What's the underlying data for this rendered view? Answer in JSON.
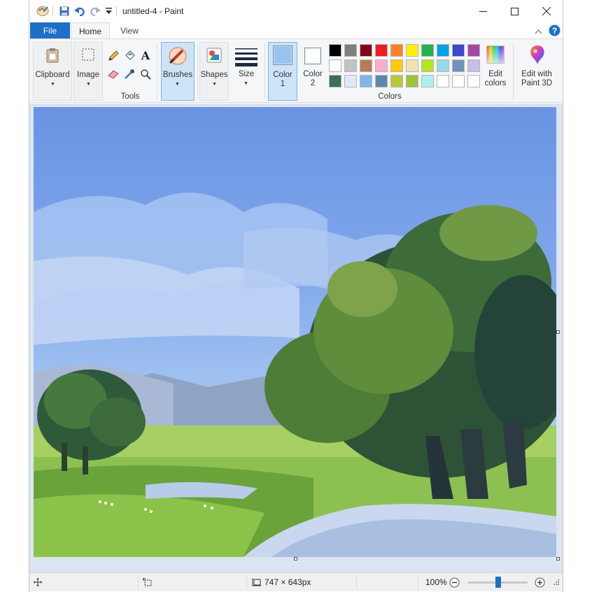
{
  "window": {
    "title": "untitled-4 - Paint",
    "controls": [
      "minimize",
      "maximize",
      "close"
    ]
  },
  "quick_access": [
    "paint-app-icon",
    "save-icon",
    "undo-icon",
    "redo-icon",
    "customize-dropdown-icon"
  ],
  "tabs": [
    {
      "label": "File",
      "active": false
    },
    {
      "label": "Home",
      "active": true
    },
    {
      "label": "View",
      "active": false
    }
  ],
  "ribbon": {
    "clipboard_label": "Clipboard",
    "image_label": "Image",
    "tools_label": "Tools",
    "brushes_label": "Brushes",
    "shapes_label": "Shapes",
    "size_label": "Size",
    "color1_line1": "Color",
    "color1_line2": "1",
    "color2_line1": "Color",
    "color2_line2": "2",
    "colors_label": "Colors",
    "edit_colors_line1": "Edit",
    "edit_colors_line2": "colors",
    "paint3d_line1": "Edit with",
    "paint3d_line2": "Paint 3D",
    "color1_value": "#99c2ef",
    "color2_value": "#ffffff",
    "palette_row1": [
      "#000000",
      "#7f7f7f",
      "#880015",
      "#ed1c24",
      "#ff7f27",
      "#fff200",
      "#22b14c",
      "#00a2e8",
      "#3f48cc",
      "#a349a4"
    ],
    "palette_row2": [
      "#ffffff",
      "#c3c3c3",
      "#b97a57",
      "#ffaec9",
      "#ffc90e",
      "#efe4b0",
      "#b5e61d",
      "#99d9ea",
      "#7092be",
      "#c8bfe7"
    ],
    "palette_row3": [
      "#3f6e5a",
      "#dfe8f8",
      "#84b4e6",
      "#5f86b0",
      "#b9c93a",
      "#9fc33b",
      "#aeeef0",
      "#ffffff",
      "#ffffff",
      "#ffffff"
    ]
  },
  "status": {
    "image_size": "747 × 643px",
    "zoom": "100%",
    "zoom_level": 0.5
  }
}
